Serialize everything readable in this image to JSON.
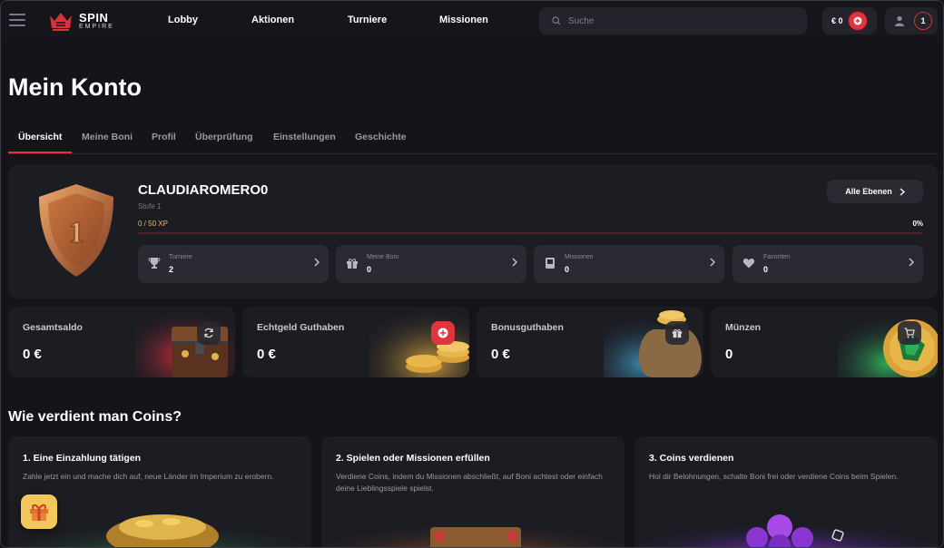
{
  "header": {
    "logo": {
      "line1": "SPIN",
      "line2": "EMPIRE"
    },
    "nav": [
      "Lobby",
      "Aktionen",
      "Turniere",
      "Missionen"
    ],
    "search_placeholder": "Suche",
    "wallet": "€ 0",
    "notifications": "1"
  },
  "page": {
    "title": "Mein Konto",
    "tabs": [
      "Übersicht",
      "Meine Boni",
      "Profil",
      "Überprüfung",
      "Einstellungen",
      "Geschichte"
    ]
  },
  "profile": {
    "badge_level": "1",
    "username": "CLAUDIAROMERO0",
    "level_label": "Stufe 1",
    "xp": "0 / 50 XP",
    "progress": "0%",
    "levels_button": "Alle Ebenen",
    "stats": [
      {
        "label": "Turniere",
        "value": "2",
        "icon": "trophy-icon"
      },
      {
        "label": "Meine Boni",
        "value": "0",
        "icon": "gift-icon"
      },
      {
        "label": "Missionen",
        "value": "0",
        "icon": "book-icon"
      },
      {
        "label": "Favoriten",
        "value": "0",
        "icon": "heart-icon"
      }
    ]
  },
  "balances": [
    {
      "label": "Gesamtsaldo",
      "value": "0 €",
      "icon": "refresh-icon"
    },
    {
      "label": "Echtgeld Guthaben",
      "value": "0 €",
      "icon": "plus-icon"
    },
    {
      "label": "Bonusguthaben",
      "value": "0 €",
      "icon": "gift-icon"
    },
    {
      "label": "Münzen",
      "value": "0",
      "icon": "cart-icon"
    }
  ],
  "coins_section": {
    "title": "Wie verdient man Coins?",
    "steps": [
      {
        "title": "1. Eine Einzahlung tätigen",
        "desc": "Zahle jetzt ein und mache dich auf, neue Länder im Imperium zu erobern."
      },
      {
        "title": "2. Spielen oder Missionen erfüllen",
        "desc": "Verdiene Coins, indem du Missionen abschließt, auf Boni achtest oder einfach deine Lieblingsspiele spielst."
      },
      {
        "title": "3. Coins verdienen",
        "desc": "Hol dir Belohnungen, schalte Boni frei oder verdiene Coins beim Spielen."
      }
    ]
  },
  "colors": {
    "accent": "#e0353f",
    "bg": "#141419",
    "card": "#1c1c23",
    "xp": "#e9b86a"
  }
}
